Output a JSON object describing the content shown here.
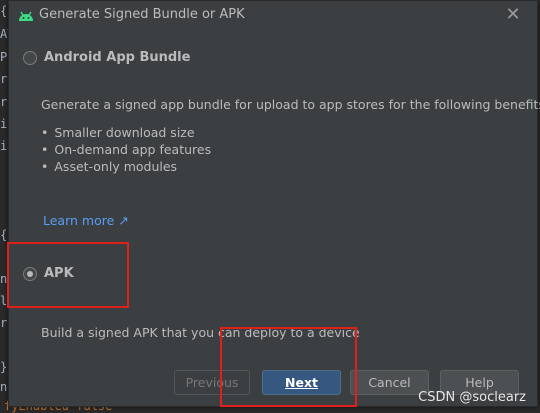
{
  "editor": {
    "lines": [
      "{",
      "AT",
      "Pa",
      "re",
      "re",
      "ig",
      "ig",
      "{",
      "ni",
      "li",
      "rg",
      "}",
      "ni",
      "fyEnabled false"
    ]
  },
  "dialog": {
    "title": "Generate Signed Bundle or APK",
    "close_glyph": "✕",
    "bundle_option": {
      "label": "Android App Bundle",
      "selected": false
    },
    "bundle_description": "Generate a signed app bundle for upload to app stores for the following benefits:",
    "benefits": [
      "Smaller download size",
      "On-demand app features",
      "Asset-only modules"
    ],
    "learn_more": "Learn more ↗",
    "apk_option": {
      "label": "APK",
      "selected": true
    },
    "apk_description": "Build a signed APK that you can deploy to a device",
    "buttons": {
      "previous": "Previous",
      "next": "Next",
      "cancel": "Cancel",
      "help": "Help"
    }
  },
  "watermark": "CSDN @soclearz",
  "colors": {
    "dialog_bg": "#3c3f41",
    "link": "#589df6",
    "primary_button": "#365880",
    "highlight_box": "#e0201d",
    "android_icon": "#3ddc84"
  }
}
